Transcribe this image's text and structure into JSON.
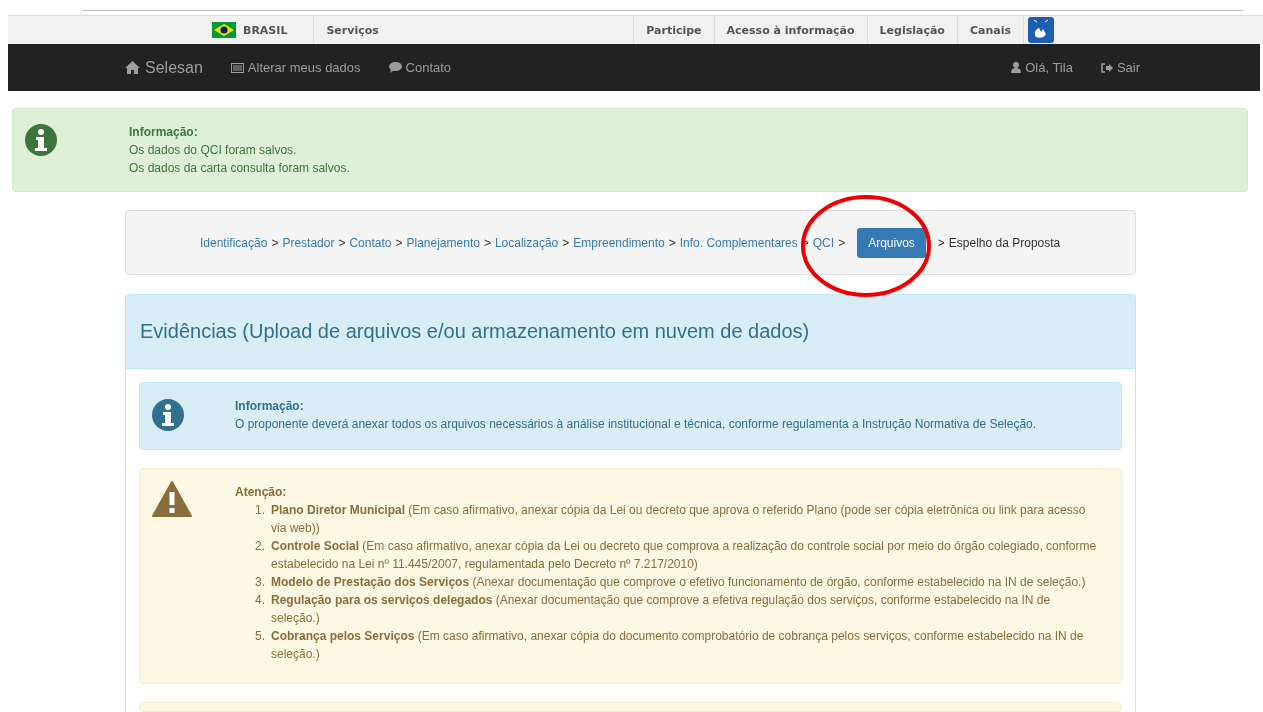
{
  "gov_bar": {
    "country": "BRASIL",
    "left_links": [
      "Serviços"
    ],
    "right_links": [
      "Participe",
      "Acesso à informação",
      "Legislação",
      "Canais"
    ]
  },
  "navbar": {
    "brand": "Selesan",
    "links": [
      {
        "label": "Alterar meus dados"
      },
      {
        "label": "Contato"
      }
    ],
    "user": "Olá, Tila",
    "logout": "Sair"
  },
  "success_alert": {
    "title": "Informação:",
    "lines": [
      "Os dados do QCI foram salvos.",
      "Os dados da carta consulta foram salvos."
    ]
  },
  "breadcrumb": {
    "separator": ">",
    "steps": [
      {
        "label": "Identificação",
        "kind": "link"
      },
      {
        "label": "Prestador",
        "kind": "link"
      },
      {
        "label": "Contato",
        "kind": "link"
      },
      {
        "label": "Planejamento",
        "kind": "link"
      },
      {
        "label": "Localização",
        "kind": "link"
      },
      {
        "label": "Empreendimento",
        "kind": "link"
      },
      {
        "label": "Info. Complementares",
        "kind": "link"
      },
      {
        "label": "QCI",
        "kind": "link"
      },
      {
        "label": "Arquivos",
        "kind": "current"
      },
      {
        "label": "Espelho da Proposta",
        "kind": "text"
      }
    ]
  },
  "panel": {
    "title": "Evidências (Upload de arquivos e/ou armazenamento em nuvem de dados)",
    "info_alert": {
      "title": "Informação:",
      "text": "O proponente deverá anexar todos os arquivos necessários à análise institucional e técnica, conforme regulamenta a Instrução Normativa de Seleção."
    },
    "warning_alert": {
      "title": "Atenção:",
      "items": [
        {
          "number": "1.",
          "text": "**Plano Diretor Municipal** (Em caso afirmativo, anexar cópia da Lei ou decreto que aprova o referido Plano (pode ser cópia eletrônica ou link para acesso via web))"
        },
        {
          "number": "2.",
          "text": "**Controle Social** (Em caso afirmativo, anexar cópia da Lei ou decreto que comprova a realização do controle social por meio do órgão colegiado, conforme estabelecido na Lei nº 11.445/2007, regulamentada pelo Decreto nº 7.217/2010)"
        },
        {
          "number": "3.",
          "text": "**Modelo de Prestação dos Serviços** (Anexar documentação que comprove o efetivo funcionamento de órgão, conforme estabelecido na IN de seleção.)"
        },
        {
          "number": "4.",
          "text": "**Regulação para os serviços delegados** (Anexar documentação que comprove a efetiva regulação dos serviços, conforme estabelecido na IN de seleção.)"
        },
        {
          "number": "5.",
          "text": "**Cobrança pelos Serviços** (Em caso afirmativo, anexar cópia do documento comprobatório de cobrança pelos serviços, conforme estabelecido na IN de seleção.)"
        }
      ]
    }
  }
}
